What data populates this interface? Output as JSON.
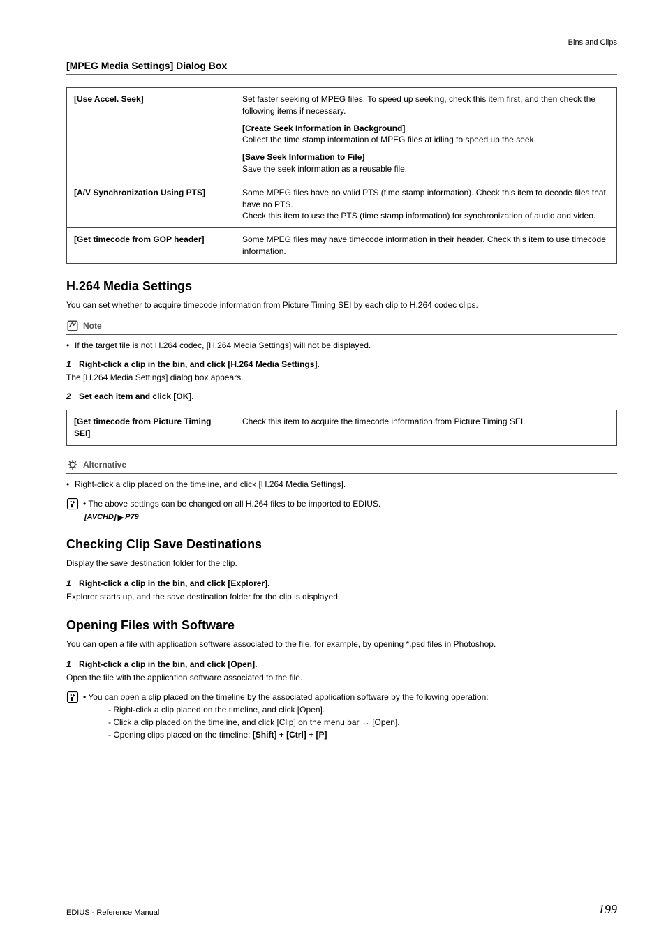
{
  "header": {
    "category": "Bins and Clips"
  },
  "mpeg_dialog": {
    "title": "[MPEG Media Settings] Dialog Box",
    "rows": [
      {
        "label": "[Use Accel. Seek]",
        "body": "Set faster seeking of MPEG files. To speed up seeking, check this item first, and then check the following items if necessary.",
        "sub1_h": "[Create Seek Information in Background]",
        "sub1_b": "Collect the time stamp information of MPEG files at idling to speed up the seek.",
        "sub2_h": "[Save Seek Information to File]",
        "sub2_b": "Save the seek information as a reusable file."
      },
      {
        "label": "[A/V Synchronization Using PTS]",
        "body": "Some MPEG files have no valid PTS (time stamp information). Check this item to decode files that have no PTS.\nCheck this item to use the PTS (time stamp information) for synchronization of audio and video."
      },
      {
        "label": "[Get timecode from GOP header]",
        "body": "Some MPEG files may have timecode information in their header. Check this item to use timecode information."
      }
    ]
  },
  "h264": {
    "title": "H.264 Media Settings",
    "lead": "You can set whether to acquire timecode information from Picture Timing SEI by each clip to H.264 codec clips.",
    "note_label": "Note",
    "note_item": "If the target file is not H.264 codec, [H.264 Media Settings] will not be displayed.",
    "step1_num": "1",
    "step1_txt": "Right-click a clip in the bin, and click [H.264 Media Settings].",
    "step1_after": "The [H.264 Media Settings] dialog box appears.",
    "step2_num": "2",
    "step2_txt": "Set each item and click [OK].",
    "table_label": "[Get timecode from Picture Timing SEI]",
    "table_body": "Check this item to acquire the timecode information from Picture Timing SEI.",
    "alt_label": "Alternative",
    "alt_item": "Right-click a clip placed on the timeline, and click [H.264 Media Settings].",
    "info_item": "The above settings can be changed on all H.264 files to be imported to EDIUS.",
    "xref_label": "[AVCHD]",
    "xref_page": "P79"
  },
  "savedest": {
    "title": "Checking Clip Save Destinations",
    "lead": "Display the save destination folder for the clip.",
    "step1_num": "1",
    "step1_txt": "Right-click a clip in the bin, and click [Explorer].",
    "step1_after": "Explorer starts up, and the save destination folder for the clip is displayed."
  },
  "opening": {
    "title": "Opening Files with Software",
    "lead": "You can open a file with application software associated to the file, for example, by opening *.psd files in Photoshop.",
    "step1_num": "1",
    "step1_txt": "Right-click a clip in the bin, and click [Open].",
    "step1_after": "Open the file with the application software associated to the file.",
    "info_item": "You can open a clip placed on the timeline by the associated application software by the following operation:",
    "dash1": "Right-click a clip placed on the timeline, and click [Open].",
    "dash2": "Click a clip placed on the timeline, and click [Clip] on the menu bar → [Open].",
    "dash3_pre": "Opening clips placed on the timeline: ",
    "dash3_keys": "[Shift] + [Ctrl] + [P]"
  },
  "footer": {
    "left": "EDIUS - Reference Manual",
    "page": "199"
  }
}
